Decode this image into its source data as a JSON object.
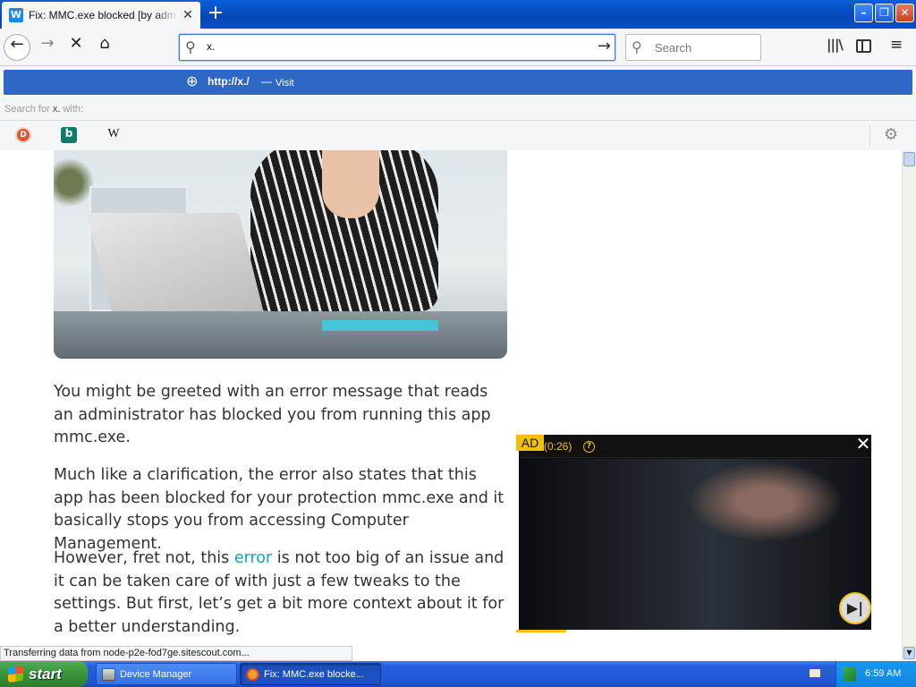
{
  "browser": {
    "tab": {
      "favicon": "W",
      "title": "Fix: MMC.exe blocked [by administrator]",
      "close": "✕"
    },
    "new_tab": "+",
    "window_controls": {
      "minimize": "–",
      "maximize": "❐",
      "close": "✕"
    },
    "nav": {
      "back_icon": "←",
      "forward_icon": "→",
      "stop_icon": "✕",
      "home_icon": "⌂",
      "url_input": "x.",
      "url_search_icon": "⚲",
      "url_go_icon": "→",
      "search_placeholder": "Search",
      "library_icon": "|||\\",
      "menu_icon": "≡"
    },
    "dropdown": {
      "suggestion_globe": "⊕",
      "suggestion_url": "http://x./",
      "suggestion_separator": "—",
      "suggestion_action": "Visit",
      "search_for_prefix": "Search for ",
      "search_for_term": "x.",
      "search_for_suffix": " with:",
      "engines": [
        {
          "name": "duckduckgo-icon",
          "glyph": "D"
        },
        {
          "name": "bing-icon",
          "glyph": "b"
        },
        {
          "name": "wikipedia-icon",
          "glyph": "W"
        }
      ],
      "settings_icon": "⚙"
    }
  },
  "article": {
    "paragraph_1": "You might be greeted with an error message that reads an administrator has blocked you from running this app mmc.exe.",
    "paragraph_2": "Much like a clarification, the error also states that this app has been blocked for your protection mmc.exe and it basically stops you from accessing Computer Management.",
    "paragraph_3_before": "However, fret not, this ",
    "paragraph_3_link": "error",
    "paragraph_3_after": " is not too big of an issue and it can be taken care of with just a few tweaks to the settings. But first, let’s get a bit more context about it for a better understanding."
  },
  "ad": {
    "badge": "AD",
    "timer": "(0:26)",
    "help": "?",
    "close": "✕",
    "skip_icon": "▶|",
    "progress_fraction": 0.14
  },
  "status_text": "Transferring data from node-p2e-fod7ge.sitescout.com...",
  "taskbar": {
    "start_label": "start",
    "tasks": [
      {
        "label": "Device Manager"
      },
      {
        "label": "Fix: MMC.exe blocke..."
      }
    ],
    "clock": "6:59 AM"
  },
  "colors": {
    "link": "#1a9fbd",
    "suggestion_highlight": "#2f67c7",
    "ad_accent": "#f2c200"
  }
}
